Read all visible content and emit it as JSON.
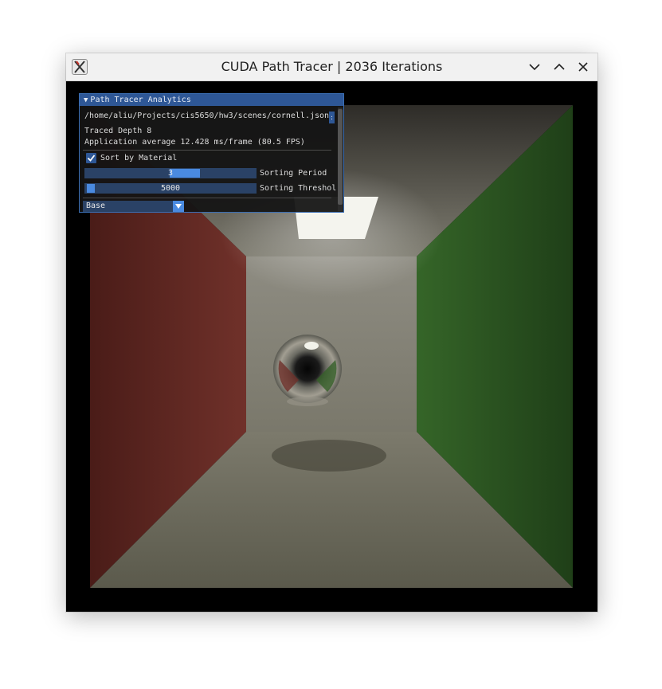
{
  "window": {
    "title": "CUDA Path Tracer | 2036 Iterations",
    "icon": "x11-app-icon",
    "controls": [
      "minimize-icon",
      "maximize-icon",
      "close-icon"
    ]
  },
  "panel": {
    "title": "Path Tracer Analytics",
    "scene_path": "/home/aliu/Projects/cis5650/hw3/scenes/cornell.json",
    "scroll_glyph": ":",
    "traced_depth": "Traced Depth 8",
    "app_average": "Application average 12.428 ms/frame (80.5 FPS)",
    "sort_by_material": {
      "label": "Sort by Material",
      "checked": true
    },
    "sorting_period": {
      "label": "Sorting Period",
      "value": "3"
    },
    "sorting_threshold": {
      "label": "Sorting Threshol",
      "value": "5000"
    },
    "mode_select": {
      "value": "Base"
    }
  },
  "colors": {
    "panel_accent": "#2e5796",
    "slider_grab": "#4a8ae0",
    "left_wall": "#6b2a24",
    "right_wall": "#2e5a23",
    "back_wall": "#8a887c"
  }
}
